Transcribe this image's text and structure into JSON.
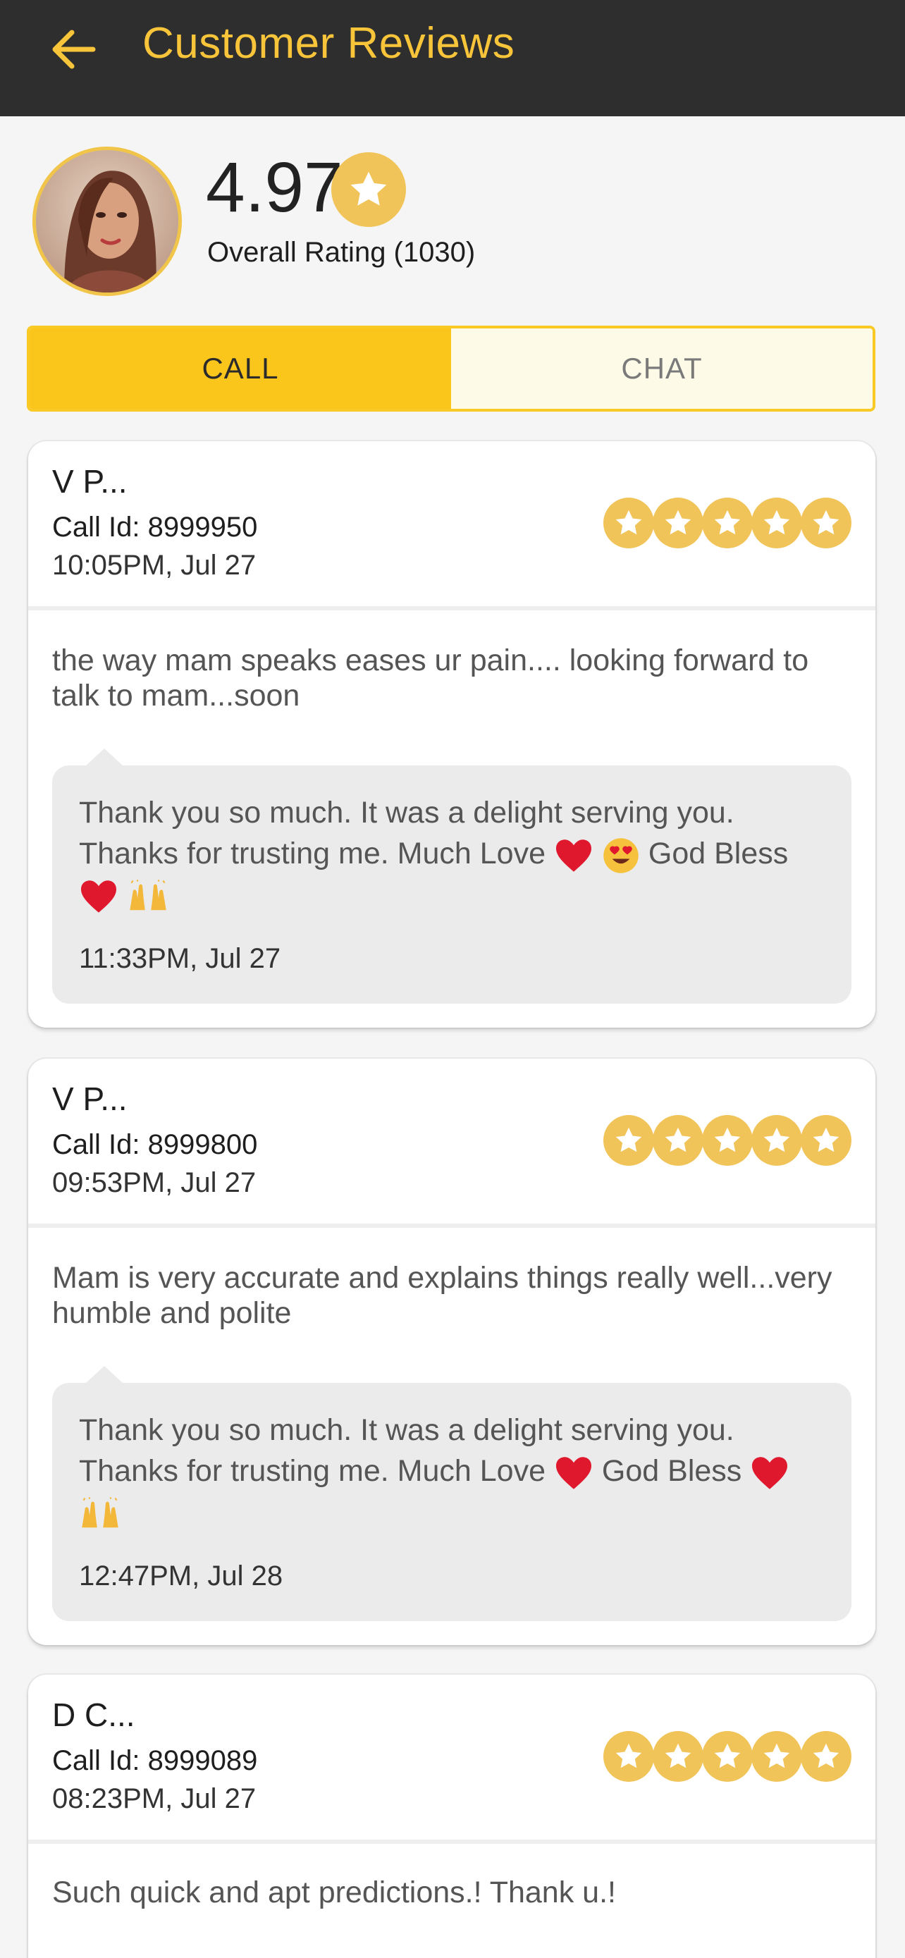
{
  "header": {
    "back_icon": "arrow-left-icon",
    "title": "Customer Reviews"
  },
  "profile": {
    "rating": "4.97",
    "rating_label": "Overall Rating (1030)"
  },
  "tabs": [
    {
      "label": "CALL",
      "active": true
    },
    {
      "label": "CHAT",
      "active": false
    }
  ],
  "reviews": [
    {
      "reviewer": "V P...",
      "call_id": "Call Id: 8999950",
      "time": "10:05PM, Jul 27",
      "stars": 5,
      "text": "the way mam speaks eases ur pain.... looking forward to talk to mam...soon",
      "reply_line1": "Thank you so much. It was a delight serving you.",
      "reply_line2": "Thanks for trusting me. Much Love",
      "reply_line2b": "God Bless",
      "reply_time": "11:33PM, Jul 27"
    },
    {
      "reviewer": "V P...",
      "call_id": "Call Id: 8999800",
      "time": "09:53PM, Jul 27",
      "stars": 5,
      "text": "Mam is very accurate and explains things really well...very humble and polite",
      "reply_line1": "Thank you so much. It was a delight serving you.",
      "reply_line2": "Thanks for trusting me. Much Love",
      "reply_line2b": "God Bless",
      "reply_time": "12:47PM, Jul 28"
    },
    {
      "reviewer": "D C...",
      "call_id": "Call Id: 8999089",
      "time": "08:23PM, Jul 27",
      "stars": 5,
      "text": "Such quick and apt predictions.! Thank u.!"
    }
  ],
  "colors": {
    "header_bg": "#2e2e2e",
    "accent": "#f8c53a",
    "tab_active": "#fac61c",
    "star": "#f1c45a",
    "heart": "#e0182d"
  }
}
